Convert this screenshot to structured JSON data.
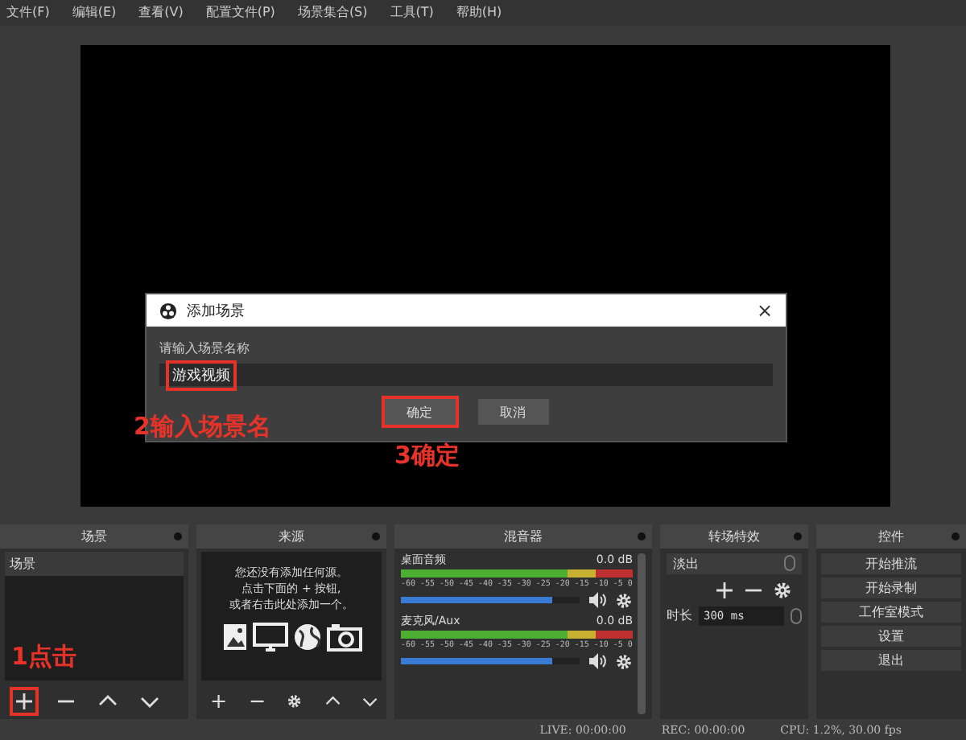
{
  "menu": [
    "文件(F)",
    "编辑(E)",
    "查看(V)",
    "配置文件(P)",
    "场景集合(S)",
    "工具(T)",
    "帮助(H)"
  ],
  "dialog": {
    "title": "添加场景",
    "close": "×",
    "label": "请输入场景名称",
    "value": "游戏视频",
    "value_highlighted": true,
    "buttons": [
      {
        "label": "确定",
        "highlighted": true
      },
      {
        "label": "取消",
        "highlighted": false
      }
    ]
  },
  "annotations": [
    {
      "text": "2输入场景名",
      "kind": "name"
    },
    {
      "text": "3确定",
      "kind": "confirm"
    },
    {
      "text": "1点击",
      "kind": "add"
    }
  ],
  "scenes": {
    "title": "场景",
    "items": [
      {
        "label": "场景",
        "selected": true
      }
    ],
    "toolbar": [
      {
        "kind": "add",
        "highlighted": true
      },
      {
        "kind": "remove",
        "highlighted": false
      },
      {
        "kind": "up",
        "highlighted": false
      },
      {
        "kind": "down",
        "highlighted": false
      }
    ]
  },
  "sources": {
    "title": "来源",
    "empty_text": [
      "您还没有添加任何源。",
      "点击下面的 + 按钮,",
      "或者右击此处添加一个。"
    ],
    "toolbar": [
      {
        "kind": "add"
      },
      {
        "kind": "remove"
      },
      {
        "kind": "settings"
      },
      {
        "kind": "up"
      },
      {
        "kind": "down"
      }
    ]
  },
  "mixer": {
    "title": "混音器",
    "channels": [
      {
        "name": "桌面音频",
        "reading": "0.0 dB",
        "level": 0.85,
        "meter_ticks": [
          "-60",
          "-55",
          "-50",
          "-45",
          "-40",
          "-35",
          "-30",
          "-25",
          "-20",
          "-15",
          "-10",
          "-5",
          "0"
        ]
      },
      {
        "name": "麦克风/Aux",
        "reading": "0.0 dB",
        "level": 0.85,
        "meter_ticks": [
          "-60",
          "-55",
          "-50",
          "-45",
          "-40",
          "-35",
          "-30",
          "-25",
          "-20",
          "-15",
          "-10",
          "-5",
          "0"
        ]
      }
    ]
  },
  "transitions": {
    "title": "转场特效",
    "selected": "淡出",
    "duration_label": "时长",
    "duration": "300 ms"
  },
  "controls": {
    "title": "控件",
    "buttons": [
      "开始推流",
      "开始录制",
      "工作室模式",
      "设置",
      "退出"
    ]
  },
  "status_bar": [
    "LIVE: 00:00:00",
    "REC: 00:00:00",
    "CPU: 1.2%, 30.00 fps"
  ]
}
